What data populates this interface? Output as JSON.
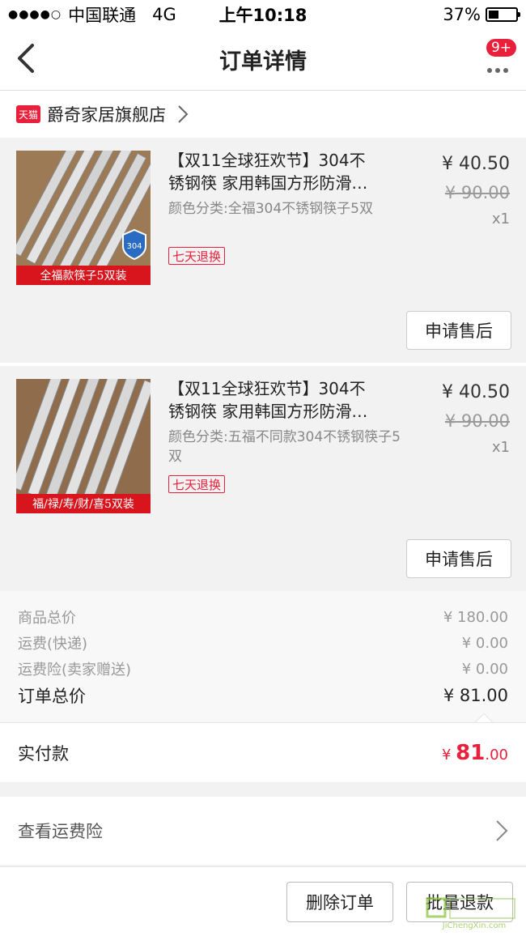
{
  "status_bar": {
    "carrier": "中国联通",
    "network": "4G",
    "time": "上午10:18",
    "battery": "37%",
    "battery_level": 0.37
  },
  "nav": {
    "title": "订单详情",
    "badge": "9+"
  },
  "shop": {
    "logo_text": "天猫",
    "name": "爵奇家居旗舰店"
  },
  "items": [
    {
      "title_line1": "【双11全球狂欢节】304不",
      "title_line2": "锈钢筷 家用韩国方形防滑…",
      "sku": "颜色分类:全福304不锈钢筷子5双",
      "return_tag": "七天退换",
      "price": "¥ 40.50",
      "orig_price": "¥ 90.00",
      "qty": "x1",
      "image_banner": "全福款筷子5双装",
      "after_sale": "申请售后"
    },
    {
      "title_line1": "【双11全球狂欢节】304不",
      "title_line2": "锈钢筷 家用韩国方形防滑…",
      "sku": "颜色分类:五福不同款304不锈钢筷子5双",
      "return_tag": "七天退换",
      "price": "¥ 40.50",
      "orig_price": "¥ 90.00",
      "qty": "x1",
      "image_banner": "福/禄/寿/财/喜5双装",
      "after_sale": "申请售后"
    }
  ],
  "summary": {
    "goods_total_label": "商品总价",
    "goods_total": "¥ 180.00",
    "shipping_label": "运费(快递)",
    "shipping": "¥ 0.00",
    "insurance_label": "运费险(卖家赠送)",
    "insurance": "¥ 0.00",
    "order_total_label": "订单总价",
    "order_total": "¥ 81.00"
  },
  "paid": {
    "label": "实付款",
    "currency": "¥ ",
    "amount_int": "81",
    "amount_dec": ".00"
  },
  "insurance_link": {
    "label": "查看运费险"
  },
  "footer": {
    "delete": "删除订单",
    "refund": "批量退款"
  },
  "watermark": {
    "text": "JiChengXin.com"
  },
  "colors": {
    "accent": "#e8203c",
    "background": "#f2f2f2"
  }
}
